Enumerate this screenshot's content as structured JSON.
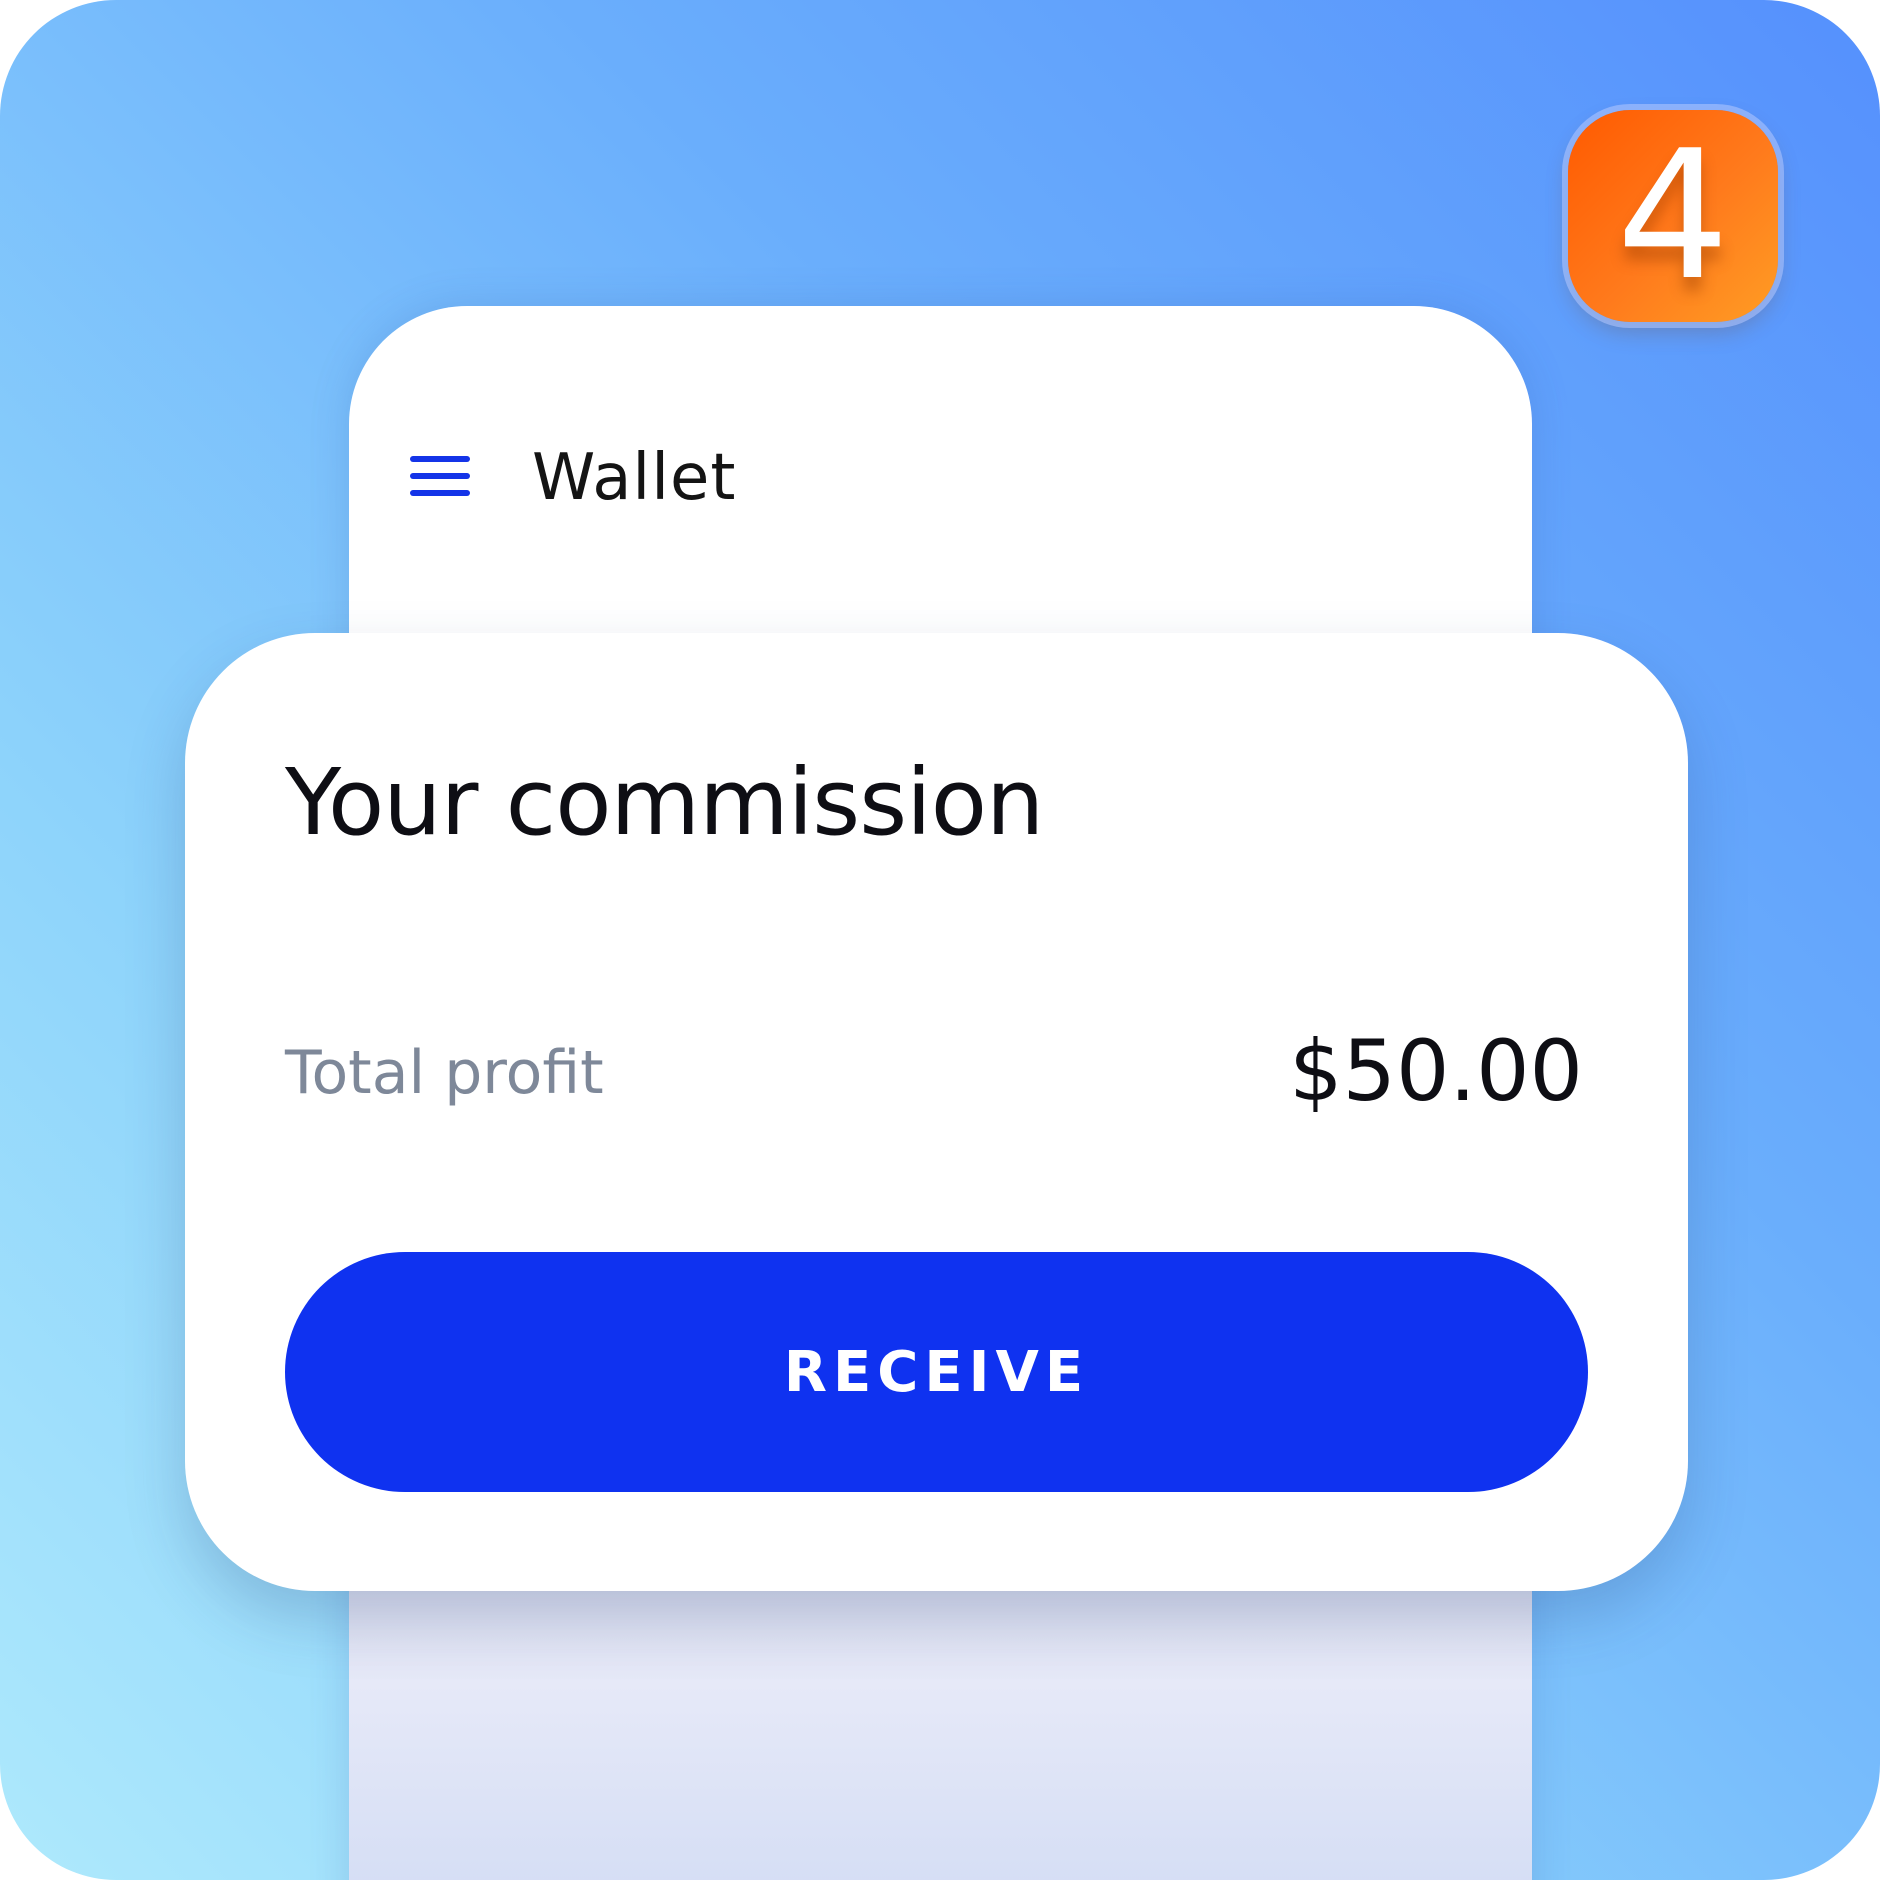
{
  "app": {
    "title": "Wallet"
  },
  "step_badge": {
    "number": "4"
  },
  "commission_card": {
    "title": "Your commission",
    "profit_label": "Total profit",
    "profit_value": "$50.00",
    "receive_label": "RECEIVE"
  },
  "colors": {
    "accent": "#0f32f0",
    "badge": "#ff6a0f",
    "muted_text": "#7e8899",
    "background_top": "#5590fd",
    "background_bottom": "#aee9fc"
  },
  "icons": {
    "menu": "hamburger-menu-icon"
  }
}
